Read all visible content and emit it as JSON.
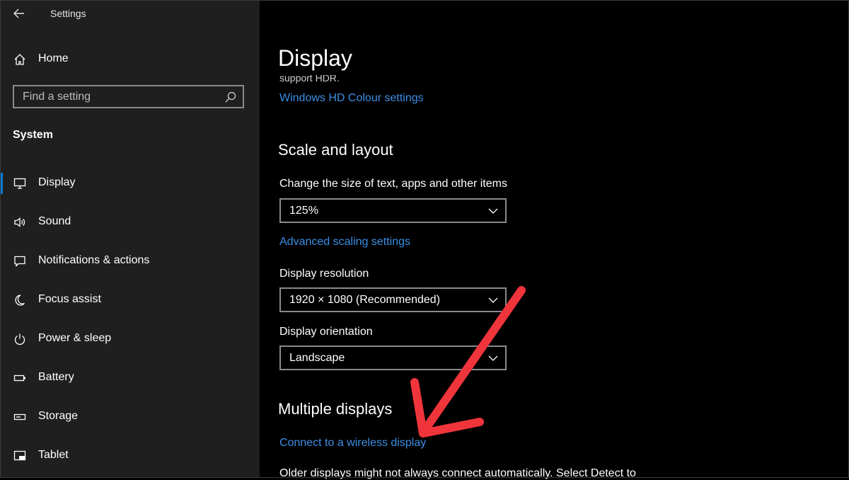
{
  "window": {
    "title": "Settings"
  },
  "sidebar": {
    "home_label": "Home",
    "search_placeholder": "Find a setting",
    "section_label": "System",
    "items": [
      {
        "label": "Display",
        "icon": "monitor-icon",
        "active": true
      },
      {
        "label": "Sound",
        "icon": "speaker-icon"
      },
      {
        "label": "Notifications & actions",
        "icon": "notification-icon"
      },
      {
        "label": "Focus assist",
        "icon": "moon-icon"
      },
      {
        "label": "Power & sleep",
        "icon": "power-icon"
      },
      {
        "label": "Battery",
        "icon": "battery-icon"
      },
      {
        "label": "Storage",
        "icon": "storage-icon"
      },
      {
        "label": "Tablet",
        "icon": "tablet-icon"
      }
    ]
  },
  "main": {
    "title": "Display",
    "cut_text": "support HDR.",
    "hd_colour_link": "Windows HD Colour settings",
    "scale_layout": {
      "heading": "Scale and layout",
      "size_label": "Change the size of text, apps and other items",
      "size_value": "125%",
      "advanced_link": "Advanced scaling settings",
      "resolution_label": "Display resolution",
      "resolution_value": "1920 × 1080 (Recommended)",
      "orientation_label": "Display orientation",
      "orientation_value": "Landscape"
    },
    "multiple_displays": {
      "heading": "Multiple displays",
      "connect_link": "Connect to a wireless display",
      "older_text": "Older displays might not always connect automatically. Select Detect to"
    }
  },
  "colors": {
    "accent": "#0a79d6",
    "link": "#3c8fe6",
    "sidebar_bg": "#1f1f1f",
    "main_bg": "#000000",
    "annotation_arrow": "#f0343c"
  }
}
